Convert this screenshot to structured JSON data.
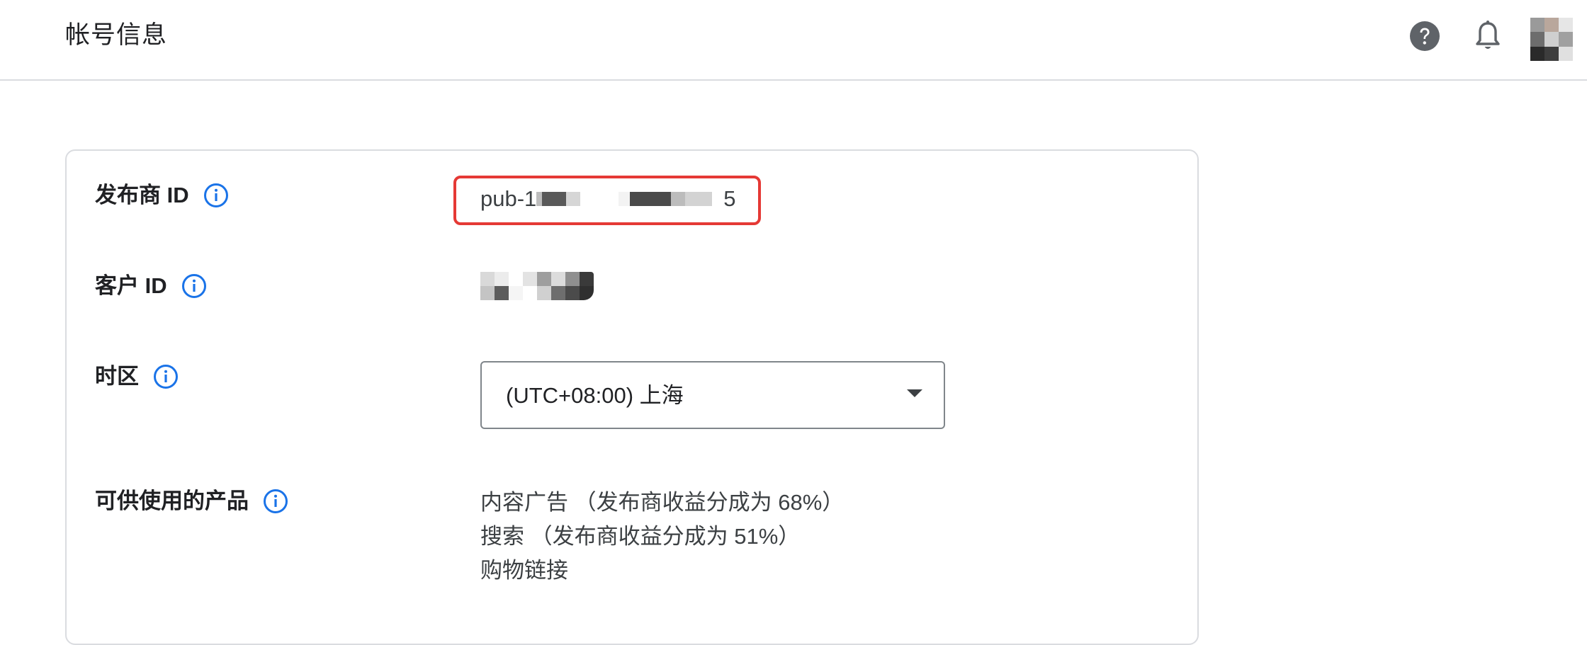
{
  "header": {
    "title": "帐号信息",
    "help_icon": "help-circle-icon",
    "notifications_icon": "bell-icon",
    "avatar_colors": [
      "#9a9a9a",
      "#b9a79c",
      "#e6e6e6",
      "#6d6d6d",
      "#cfcfcf",
      "#a0a0a0",
      "#2a2a2a",
      "#3d3d3d",
      "#e0e0e0"
    ]
  },
  "account": {
    "publisher_id": {
      "label": "发布商 ID",
      "value_prefix": "pub-1",
      "value_suffix": "5",
      "highlight_color": "#e53935"
    },
    "customer_id": {
      "label": "客户 ID"
    },
    "timezone": {
      "label": "时区",
      "selected": "(UTC+08:00) 上海"
    },
    "products": {
      "label": "可供使用的产品",
      "items": [
        "内容广告 （发布商收益分成为 68%）",
        "搜索 （发布商收益分成为 51%）",
        "购物链接"
      ]
    }
  },
  "colors": {
    "accent_blue": "#1a73e8",
    "icon_grey": "#5f6368",
    "border": "#dadce0"
  }
}
